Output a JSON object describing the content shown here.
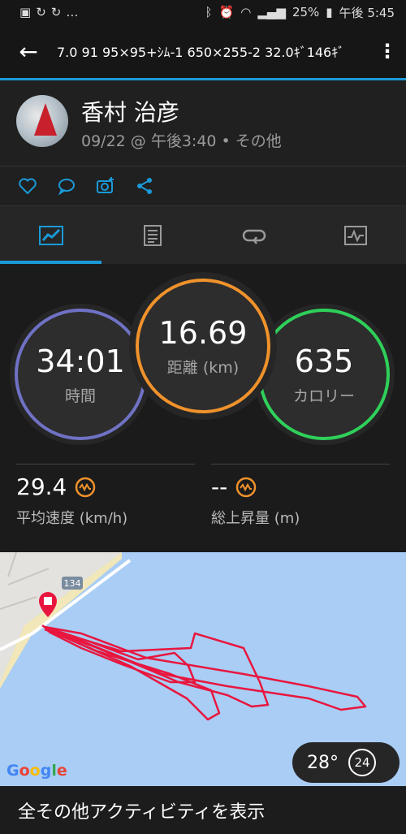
{
  "status": {
    "battery": "25%",
    "time": "午後 5:45"
  },
  "appbar": {
    "title": "7.0 91 95×95+ｼﾑ-1 650×255-2 32.0ｷﾞ146ｷﾞ"
  },
  "activity": {
    "name": "香村 治彦",
    "subtitle": "09/22 @ 午後3:40 • その他"
  },
  "stats": {
    "time_value": "34:01",
    "time_label": "時間",
    "distance_value": "16.69",
    "distance_label": "距離 (km)",
    "calories_value": "635",
    "calories_label": "カロリー",
    "speed_value": "29.4",
    "speed_label": "平均速度 (km/h)",
    "ascent_value": "--",
    "ascent_label": "総上昇量 (m)"
  },
  "map": {
    "road_number": "134",
    "google": "Google",
    "temperature": "28°",
    "wind": "24"
  },
  "footer": {
    "label": "全その他アクティビティを表示"
  },
  "colors": {
    "accent": "#1a9ad8",
    "time_ring": "#6f72c4",
    "distance_ring": "#f0922b",
    "calories_ring": "#2fd05a",
    "track": "#e8163f",
    "metric_icon": "#f0922b"
  }
}
